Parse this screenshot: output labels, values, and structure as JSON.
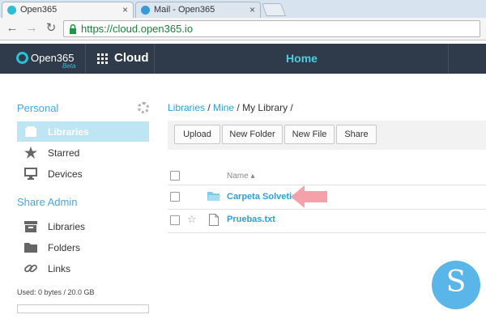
{
  "browser": {
    "tabs": [
      {
        "title": "Open365",
        "active": true
      },
      {
        "title": "Mail - Open365",
        "active": false
      }
    ],
    "close_glyph": "×",
    "nav": {
      "back": "←",
      "forward": "→",
      "reload": "↻"
    },
    "url": "https://cloud.open365.io"
  },
  "header": {
    "logo": "Open365",
    "beta": "Beta",
    "app": "Cloud",
    "page": "Home"
  },
  "sidebar": {
    "personal_heading": "Personal",
    "personal_items": [
      {
        "label": "Libraries",
        "icon": "libraries-icon",
        "active": true
      },
      {
        "label": "Starred",
        "icon": "star-icon",
        "active": false
      },
      {
        "label": "Devices",
        "icon": "monitor-icon",
        "active": false
      }
    ],
    "admin_heading": "Share Admin",
    "admin_items": [
      {
        "label": "Libraries",
        "icon": "archive-icon"
      },
      {
        "label": "Folders",
        "icon": "folder-icon"
      },
      {
        "label": "Links",
        "icon": "link-icon"
      }
    ],
    "usage_text": "Used: 0 bytes / 20.0 GB",
    "usage_fraction": 0
  },
  "main": {
    "breadcrumb": {
      "libraries": "Libraries",
      "sep1": " / ",
      "mine": "Mine",
      "sep2": " / ",
      "current": "My Library",
      "sep3": " /"
    },
    "ops": [
      "Upload",
      "New Folder",
      "New File",
      "Share"
    ],
    "column_name": "Name ▴",
    "rows": [
      {
        "name": "Carpeta Solvetic",
        "type": "folder"
      },
      {
        "name": "Pruebas.txt",
        "type": "file"
      }
    ]
  },
  "watermark": "S",
  "colors": {
    "accent": "#4ccde0",
    "link": "#2e9fd8",
    "header_bg": "#2f3b4a",
    "active_item": "#bde5f4",
    "arrow": "#f4a1a9"
  }
}
